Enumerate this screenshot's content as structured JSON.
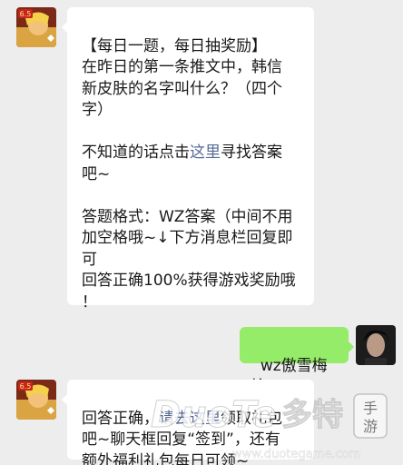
{
  "messages": [
    {
      "side": "left",
      "line1": "【每日一题，每日抽奖励】",
      "line2": "在昨日的第一条推文中，韩信",
      "line3": "新皮肤的名字叫什么？（四个",
      "line4": "字）",
      "line5a": "不知道的话点击",
      "line5link": "这里",
      "line5b": "寻找答案",
      "line6": "吧~",
      "line7": "答题格式：WZ答案（中间不用",
      "line8": "加空格哦~↓下方消息栏回复即",
      "line9": "可",
      "line10": "回答正确100%获得游戏奖励哦",
      "line11": "！"
    },
    {
      "side": "right",
      "text": "wz傲雪梅枪"
    },
    {
      "side": "left",
      "line1a": "回答正确，",
      "line1link": "请去这里",
      "line1b": "领取礼包",
      "line2": "吧~聊天框回复“签到”，还有",
      "line3": "额外福利礼包每日可领~"
    }
  ],
  "avatars": {
    "bot_badge": "6.5"
  },
  "watermark": {
    "brand": "DuoTe",
    "cn": "多特",
    "tag1": "手",
    "tag2": "游",
    "url": "www.duotegame.com"
  },
  "colors": {
    "background": "#ededed",
    "bubble_left": "#ffffff",
    "bubble_right": "#95ec69",
    "link": "#576b95"
  }
}
